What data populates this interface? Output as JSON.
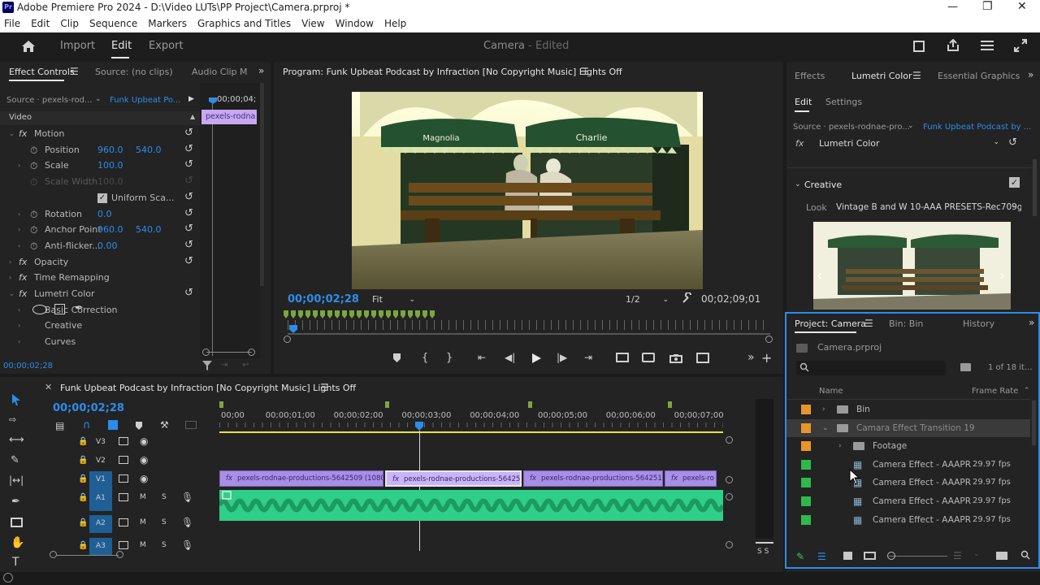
{
  "window": {
    "title": "Adobe Premiere Pro 2024 - D:\\Video LUTs\\PP Project\\Camera.prproj *",
    "app_icon": "Pr"
  },
  "menu": [
    "File",
    "Edit",
    "Clip",
    "Sequence",
    "Markers",
    "Graphics and Titles",
    "View",
    "Window",
    "Help"
  ],
  "header": {
    "tabs": [
      "Import",
      "Edit",
      "Export"
    ],
    "doc_title": "Camera",
    "doc_status": "- Edited"
  },
  "effect_controls": {
    "tabs": [
      "Effect Controls",
      "Source: (no clips)",
      "Audio Clip M"
    ],
    "source": "Source · pexels-rod...",
    "sequence": "Funk Upbeat Po...",
    "timecode_top": "00;00;04;",
    "clip_label": "pexels-rodna",
    "video_label": "Video",
    "rows": [
      {
        "name": "Motion",
        "type": "fx"
      },
      {
        "name": "Position",
        "v1": "960.0",
        "v2": "540.0"
      },
      {
        "name": "Scale",
        "v1": "100.0"
      },
      {
        "name": "Scale Width",
        "v1": "100.0",
        "disabled": true
      },
      {
        "name": "Uniform Sca...",
        "check": true
      },
      {
        "name": "Rotation",
        "v1": "0.0"
      },
      {
        "name": "Anchor Point",
        "v1": "960.0",
        "v2": "540.0"
      },
      {
        "name": "Anti-flicker...",
        "v1": "0.00"
      },
      {
        "name": "Opacity",
        "type": "fx"
      },
      {
        "name": "Time Remapping",
        "type": "fx"
      },
      {
        "name": "Lumetri Color",
        "type": "fx"
      },
      {
        "name": "Basic Correction"
      },
      {
        "name": "Creative"
      },
      {
        "name": "Curves"
      }
    ],
    "timecode_bottom": "00;00;02;28"
  },
  "program": {
    "title": "Program: Funk Upbeat Podcast by Infraction [No Copyright Music]  Lights Off",
    "timecode": "00;00;02;28",
    "fit": "Fit",
    "resolution": "1/2",
    "duration": "00;02;09;01",
    "sign_left": "Magnolia",
    "sign_right": "Charlie"
  },
  "lumetri": {
    "tabs": [
      "Effects",
      "Lumetri Color",
      "Essential Graphics"
    ],
    "subtabs": [
      "Edit",
      "Settings"
    ],
    "source": "Source · pexels-rodnae-pro...",
    "sequence": "Funk Upbeat Podcast by ...",
    "effect": "Lumetri Color",
    "section": "Creative",
    "look_label": "Look",
    "look_value": "Vintage B and W 10-AAA PRESETS-Rec709g..."
  },
  "project": {
    "tabs": [
      "Project: Camera",
      "Bin: Bin",
      "History"
    ],
    "file": "Camera.prproj",
    "count": "1 of 18 it...",
    "columns": [
      "Name",
      "Frame Rate"
    ],
    "items": [
      {
        "name": "Bin",
        "type": "bin",
        "color": "#e8962a",
        "indent": 0,
        "expanded": false,
        "rate": ""
      },
      {
        "name": "Camara Effect Transition 19",
        "type": "bin",
        "color": "#e8962a",
        "indent": 0,
        "expanded": true,
        "rate": "",
        "selected": true
      },
      {
        "name": "Footage",
        "type": "bin",
        "color": "#e8962a",
        "indent": 1,
        "expanded": false,
        "rate": ""
      },
      {
        "name": "Camera Effect - AAAPR",
        "type": "seq",
        "color": "#2fb84c",
        "indent": 1,
        "rate": "29.97 fps"
      },
      {
        "name": "Camera Effect - AAAPR",
        "type": "seq",
        "color": "#2fb84c",
        "indent": 1,
        "rate": "29.97 fps"
      },
      {
        "name": "Camera Effect - AAAPR",
        "type": "seq",
        "color": "#2fb84c",
        "indent": 1,
        "rate": "29.97 fps"
      },
      {
        "name": "Camera Effect - AAAPR",
        "type": "seq",
        "color": "#2fb84c",
        "indent": 1,
        "rate": "29.97 fps"
      }
    ]
  },
  "timeline": {
    "title": "Funk Upbeat Podcast by Infraction [No Copyright Music]  Lights Off",
    "timecode": "00;00;02;28",
    "ruler": [
      "00;00",
      "00;00;01;00",
      "00;00;02;00",
      "00;00;03;00",
      "00;00;04;00",
      "00;00;05;00",
      "00;00;06;00",
      "00;00;07;00"
    ],
    "tracks": [
      {
        "label": "V3",
        "kind": "video"
      },
      {
        "label": "V2",
        "kind": "video"
      },
      {
        "label": "V1",
        "kind": "video",
        "target": true
      },
      {
        "label": "A1",
        "kind": "audio",
        "target": true
      },
      {
        "label": "A2",
        "kind": "audio"
      },
      {
        "label": "A3",
        "kind": "audio"
      }
    ],
    "clips": [
      "pexels-rodnae-productions-5642509 (1080p)",
      "pexels-rodnae-productions-5642506 (",
      "pexels-rodnae-productions-5642513 (",
      "pexels-ro"
    ],
    "meter_label": "S S"
  },
  "colors": {
    "accent": "#2d8ceb",
    "clip_video": "#a88fe6",
    "clip_audio": "#2ecf88",
    "label_orange": "#e8962a",
    "label_green": "#2fb84c"
  }
}
